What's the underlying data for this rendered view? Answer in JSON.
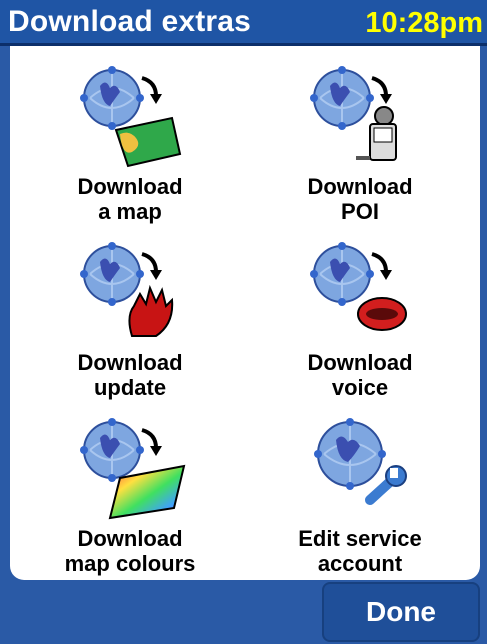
{
  "header": {
    "title": "Download extras",
    "time": "10:28pm"
  },
  "tiles": [
    {
      "label": "Download\na map",
      "icon": "download-map-icon"
    },
    {
      "label": "Download\nPOI",
      "icon": "download-poi-icon"
    },
    {
      "label": "Download\nupdate",
      "icon": "download-update-icon"
    },
    {
      "label": "Download\nvoice",
      "icon": "download-voice-icon"
    },
    {
      "label": "Download\nmap colours",
      "icon": "download-colours-icon"
    },
    {
      "label": "Edit service\naccount",
      "icon": "service-account-icon"
    }
  ],
  "footer": {
    "done_label": "Done"
  },
  "colors": {
    "header_bg": "#1f55a5",
    "clock": "#ffff00",
    "panel": "#ffffff"
  }
}
